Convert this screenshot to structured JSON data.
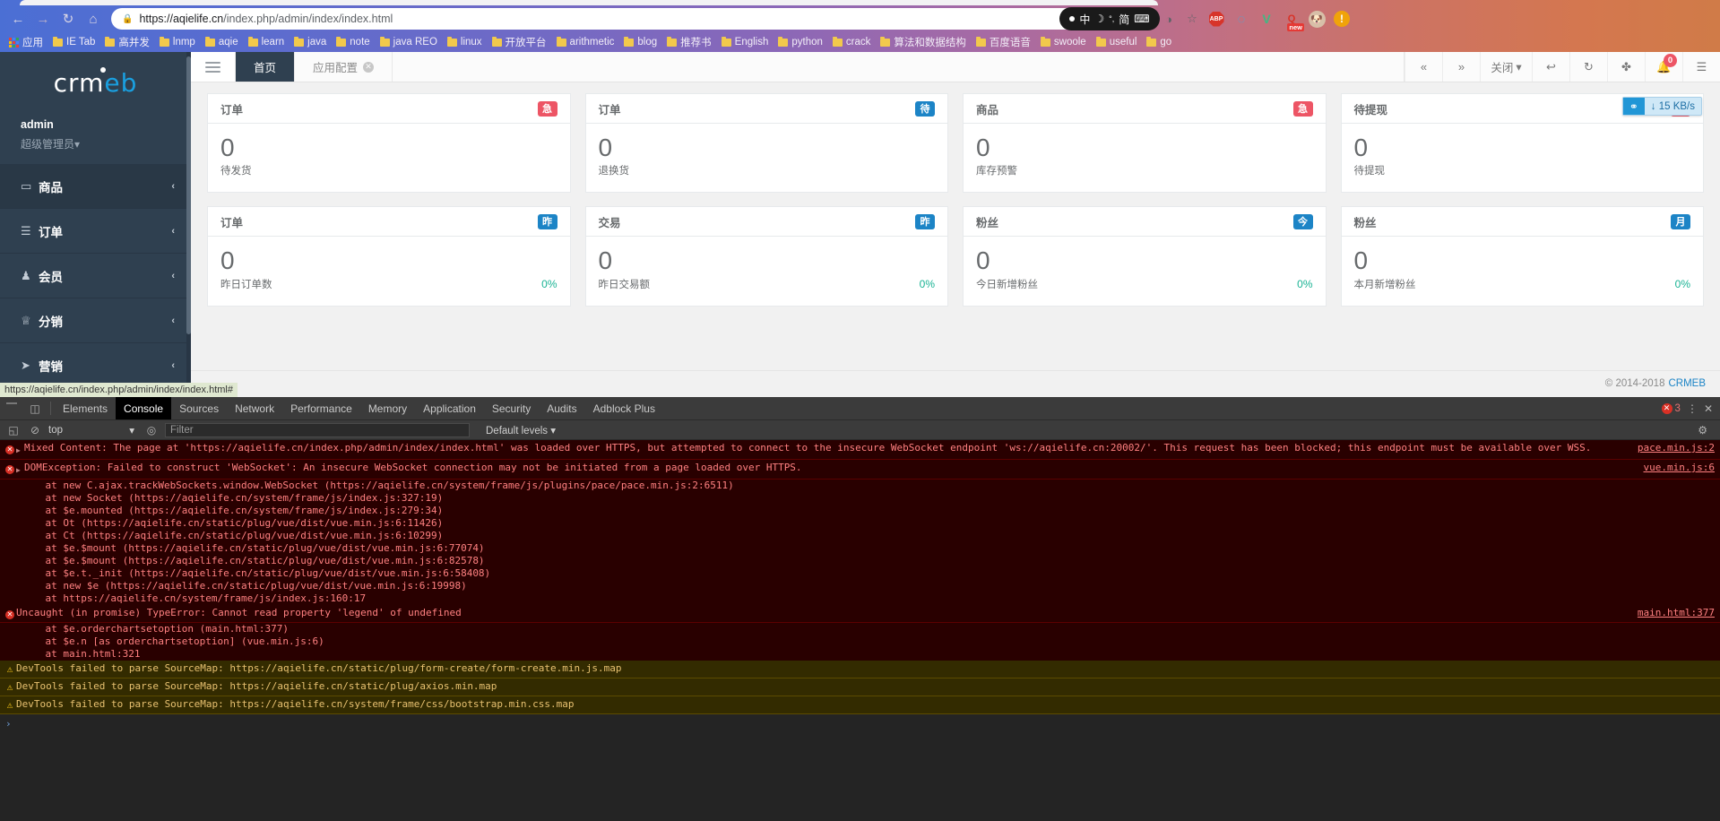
{
  "browser": {
    "nav": {
      "back": "←",
      "forward": "→",
      "reload": "↻",
      "home": "⌂"
    },
    "omnibox": {
      "lock_icon": "lock-icon",
      "url_host": "https://aqielife.cn",
      "url_path": "/index.php/admin/index/index.html"
    },
    "ime_pill": {
      "lang": "中",
      "mode": "☽",
      "shape": "简",
      "keyboard": "⌨"
    },
    "omni_right": [
      {
        "name": "reader-mode-icon",
        "glyph": "◑"
      },
      {
        "name": "bookmark-star-icon",
        "glyph": "☆"
      }
    ],
    "extensions": [
      {
        "name": "adblock-plus-icon",
        "label": "ABP"
      },
      {
        "name": "opera-vpn-icon",
        "glyph": "◌"
      },
      {
        "name": "vue-devtools-icon",
        "glyph": "V"
      },
      {
        "name": "qq-extension-icon",
        "label": "Q",
        "badge": "new"
      }
    ],
    "profile_avatar": "🐶",
    "menu_button": "⠇",
    "bookmarks": [
      {
        "label": "应用",
        "icon": "apps-grid-icon"
      },
      {
        "label": "IE Tab",
        "icon": "folder-icon"
      },
      {
        "label": "高并发",
        "icon": "folder-icon"
      },
      {
        "label": "lnmp",
        "icon": "folder-icon"
      },
      {
        "label": "aqie",
        "icon": "folder-icon"
      },
      {
        "label": "learn",
        "icon": "folder-icon"
      },
      {
        "label": "java",
        "icon": "folder-icon"
      },
      {
        "label": "note",
        "icon": "folder-icon"
      },
      {
        "label": "java REO",
        "icon": "folder-icon"
      },
      {
        "label": "linux",
        "icon": "folder-icon"
      },
      {
        "label": "开放平台",
        "icon": "folder-icon"
      },
      {
        "label": "arithmetic",
        "icon": "folder-icon"
      },
      {
        "label": "blog",
        "icon": "folder-icon"
      },
      {
        "label": "推荐书",
        "icon": "folder-icon"
      },
      {
        "label": "English",
        "icon": "folder-icon"
      },
      {
        "label": "python",
        "icon": "folder-icon"
      },
      {
        "label": "crack",
        "icon": "folder-icon"
      },
      {
        "label": "算法和数据结构",
        "icon": "folder-icon"
      },
      {
        "label": "百度语音",
        "icon": "folder-icon"
      },
      {
        "label": "swoole",
        "icon": "folder-icon"
      },
      {
        "label": "useful",
        "icon": "folder-icon"
      },
      {
        "label": "go",
        "icon": "folder-icon"
      }
    ]
  },
  "admin": {
    "logo": {
      "part1": "cr",
      "part2": "m",
      "part3": "e",
      "part4": "b"
    },
    "user": {
      "name": "admin",
      "role": "超级管理员",
      "caret": "▾"
    },
    "sidebar_items": [
      {
        "label": "商品",
        "icon": "▭",
        "icon_name": "product-icon",
        "active": true
      },
      {
        "label": "订单",
        "icon": "☰",
        "icon_name": "order-icon",
        "active": false
      },
      {
        "label": "会员",
        "icon": "♟",
        "icon_name": "member-icon",
        "active": false
      },
      {
        "label": "分销",
        "icon": "♕",
        "icon_name": "distribution-icon",
        "active": false
      },
      {
        "label": "营销",
        "icon": "➤",
        "icon_name": "marketing-icon",
        "active": false
      }
    ],
    "sidebar_chevron": "‹",
    "tabs": [
      {
        "label": "首页",
        "active": true,
        "closable": false
      },
      {
        "label": "应用配置",
        "active": false,
        "closable": true
      }
    ],
    "nav_controls": [
      {
        "name": "scroll-tabs-left-button",
        "glyph": "«"
      },
      {
        "name": "scroll-tabs-right-button",
        "glyph": "»"
      },
      {
        "name": "close-tabs-dropdown",
        "label": "关闭",
        "caret": "▾"
      },
      {
        "name": "back-button",
        "glyph": "↩"
      },
      {
        "name": "refresh-button",
        "glyph": "↻"
      },
      {
        "name": "fullscreen-button",
        "glyph": "✤"
      },
      {
        "name": "notifications-button",
        "glyph": "🔔",
        "badge": "0"
      },
      {
        "name": "layout-button",
        "glyph": "☰"
      }
    ],
    "cards_row1": [
      {
        "title": "订单",
        "badge": "急",
        "badge_color": "#ed5565",
        "value": "0",
        "sub": "待发货",
        "pct": ""
      },
      {
        "title": "订单",
        "badge": "待",
        "badge_color": "#1c84c6",
        "value": "0",
        "sub": "退换货",
        "pct": ""
      },
      {
        "title": "商品",
        "badge": "急",
        "badge_color": "#ed5565",
        "value": "0",
        "sub": "库存预警",
        "pct": ""
      },
      {
        "title": "待提现",
        "badge": "急",
        "badge_color": "#ed5565",
        "value": "0",
        "sub": "待提现",
        "pct": ""
      }
    ],
    "cards_row2": [
      {
        "title": "订单",
        "badge": "昨",
        "badge_color": "#1c84c6",
        "value": "0",
        "sub": "昨日订单数",
        "pct": "0%"
      },
      {
        "title": "交易",
        "badge": "昨",
        "badge_color": "#1c84c6",
        "value": "0",
        "sub": "昨日交易额",
        "pct": "0%"
      },
      {
        "title": "粉丝",
        "badge": "今",
        "badge_color": "#1c84c6",
        "value": "0",
        "sub": "今日新增粉丝",
        "pct": "0%"
      },
      {
        "title": "粉丝",
        "badge": "月",
        "badge_color": "#1c84c6",
        "value": "0",
        "sub": "本月新增粉丝",
        "pct": "0%"
      }
    ],
    "speed_widget": {
      "icon": "network-speed-icon",
      "arrow": "↓",
      "text": "15 KB/s"
    },
    "footer": {
      "copyright": "© 2014-2018",
      "brand": "CRMEB"
    },
    "status_url": "https://aqielife.cn/index.php/admin/index/index.html#"
  },
  "devtools": {
    "tool_icons": [
      {
        "name": "inspect-element-icon",
        "glyph": "⬚"
      },
      {
        "name": "device-toolbar-icon",
        "glyph": "▧"
      }
    ],
    "tabs": [
      {
        "label": "Elements",
        "active": false
      },
      {
        "label": "Console",
        "active": true
      },
      {
        "label": "Sources",
        "active": false
      },
      {
        "label": "Network",
        "active": false
      },
      {
        "label": "Performance",
        "active": false
      },
      {
        "label": "Memory",
        "active": false
      },
      {
        "label": "Application",
        "active": false
      },
      {
        "label": "Security",
        "active": false
      },
      {
        "label": "Audits",
        "active": false
      },
      {
        "label": "Adblock Plus",
        "active": false
      }
    ],
    "error_count": "3",
    "close_glyph": "✕",
    "more_glyph": "⋮",
    "toolbar": {
      "sidebar_toggle": "◱",
      "clear_console": "⊘",
      "context": "top",
      "context_caret": "▾",
      "filter_toggle": "◎",
      "filter_placeholder": "Filter",
      "levels": "Default levels",
      "levels_caret": "▾",
      "settings_glyph": "⚙"
    },
    "messages": [
      {
        "type": "error",
        "expandable": true,
        "text": "Mixed Content: The page at 'https://aqielife.cn/index.php/admin/index/index.html' was loaded over HTTPS, but attempted to connect to the insecure WebSocket endpoint 'ws://aqielife.cn:20002/'. This request has been blocked; this endpoint must be available over WSS.",
        "source": "pace.min.js:2",
        "stack": []
      },
      {
        "type": "error",
        "expandable": true,
        "text": "DOMException: Failed to construct 'WebSocket': An insecure WebSocket connection may not be initiated from a page loaded over HTTPS.",
        "source": "vue.min.js:6",
        "stack": [
          "    at new C.ajax.trackWebSockets.window.WebSocket (https://aqielife.cn/system/frame/js/plugins/pace/pace.min.js:2:6511)",
          "    at new Socket (https://aqielife.cn/system/frame/js/index.js:327:19)",
          "    at $e.mounted (https://aqielife.cn/system/frame/js/index.js:279:34)",
          "    at Ot (https://aqielife.cn/static/plug/vue/dist/vue.min.js:6:11426)",
          "    at Ct (https://aqielife.cn/static/plug/vue/dist/vue.min.js:6:10299)",
          "    at $e.$mount (https://aqielife.cn/static/plug/vue/dist/vue.min.js:6:77074)",
          "    at $e.$mount (https://aqielife.cn/static/plug/vue/dist/vue.min.js:6:82578)",
          "    at $e.t._init (https://aqielife.cn/static/plug/vue/dist/vue.min.js:6:58408)",
          "    at new $e (https://aqielife.cn/static/plug/vue/dist/vue.min.js:6:19998)",
          "    at https://aqielife.cn/system/frame/js/index.js:160:17"
        ]
      },
      {
        "type": "error",
        "expandable": false,
        "text": "Uncaught (in promise) TypeError: Cannot read property 'legend' of undefined",
        "source": "main.html:377",
        "stack": [
          "    at $e.orderchartsetoption (main.html:377)",
          "    at $e.n [as orderchartsetoption] (vue.min.js:6)",
          "    at main.html:321"
        ]
      },
      {
        "type": "warn",
        "expandable": false,
        "text": "DevTools failed to parse SourceMap: https://aqielife.cn/static/plug/form-create/form-create.min.js.map",
        "source": "",
        "stack": []
      },
      {
        "type": "warn",
        "expandable": false,
        "text": "DevTools failed to parse SourceMap: https://aqielife.cn/static/plug/axios.min.map",
        "source": "",
        "stack": []
      },
      {
        "type": "warn",
        "expandable": false,
        "text": "DevTools failed to parse SourceMap: https://aqielife.cn/system/frame/css/bootstrap.min.css.map",
        "source": "",
        "stack": []
      }
    ],
    "prompt_chevron": "›"
  }
}
